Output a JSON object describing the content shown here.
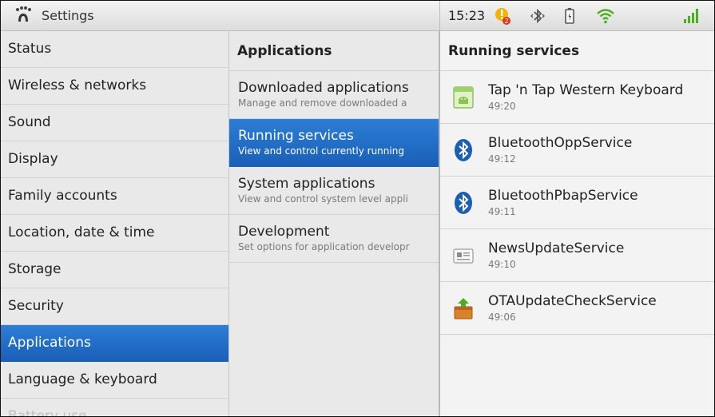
{
  "statusbar": {
    "title": "Settings",
    "time": "15:23",
    "icons": [
      "settings-app-icon",
      "alert-notification-icon",
      "bluetooth-icon",
      "battery-icon",
      "wifi-icon",
      "signal-icon"
    ],
    "colors": {
      "accent": "#1a6fd0",
      "wifi": "#4cae1f"
    }
  },
  "categories": [
    {
      "label": "Status"
    },
    {
      "label": "Wireless & networks"
    },
    {
      "label": "Sound"
    },
    {
      "label": "Display"
    },
    {
      "label": "Family accounts"
    },
    {
      "label": "Location, date & time"
    },
    {
      "label": "Storage"
    },
    {
      "label": "Security"
    },
    {
      "label": "Applications",
      "selected": true
    },
    {
      "label": "Language & keyboard"
    },
    {
      "label": "Battery use"
    }
  ],
  "applications": {
    "header": "Applications",
    "items": [
      {
        "title": "Downloaded applications",
        "subtitle": "Manage and remove downloaded a"
      },
      {
        "title": "Running services",
        "subtitle": "View and control currently running",
        "selected": true
      },
      {
        "title": "System applications",
        "subtitle": "View and control system level appli"
      },
      {
        "title": "Development",
        "subtitle": "Set options for application developr"
      }
    ]
  },
  "running_services": {
    "header": "Running services",
    "items": [
      {
        "name": "Tap 'n Tap Western Keyboard",
        "time": "49:20",
        "icon": "android-app-icon"
      },
      {
        "name": "BluetoothOppService",
        "time": "49:12",
        "icon": "bluetooth-service-icon"
      },
      {
        "name": "BluetoothPbapService",
        "time": "49:11",
        "icon": "bluetooth-service-icon"
      },
      {
        "name": "NewsUpdateService",
        "time": "49:10",
        "icon": "news-icon"
      },
      {
        "name": "OTAUpdateCheckService",
        "time": "49:06",
        "icon": "update-package-icon"
      }
    ]
  }
}
